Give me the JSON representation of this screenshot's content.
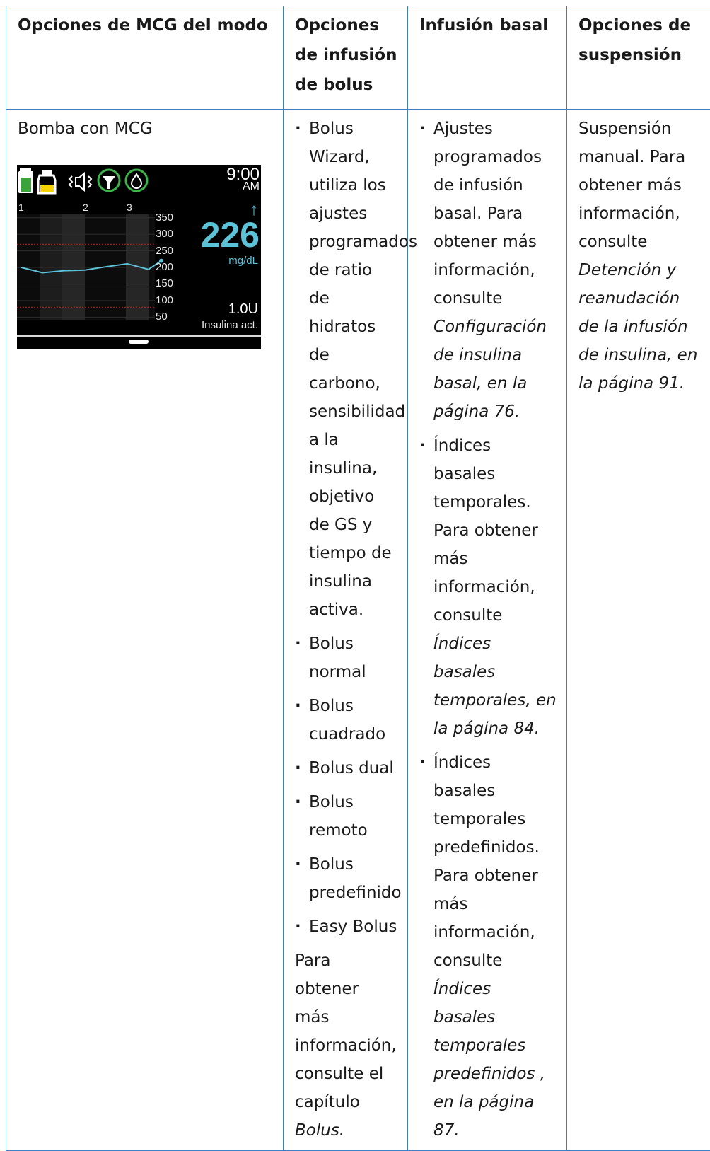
{
  "headers": {
    "col1": "Opciones de MCG del modo",
    "col2": "Opciones de infusión de bolus",
    "col3": "Infusión basal",
    "col4": "Opciones de suspensión"
  },
  "row": {
    "mode": "Bomba con MCG",
    "bolus_items": [
      "Bolus Wizard, utiliza los ajustes programados de ratio de hidratos de carbono, sensibilidad a la insulina, objetivo de GS y tiempo de insulina activa.",
      "Bolus normal",
      "Bolus cuadrado",
      "Bolus dual",
      "Bolus remoto",
      "Bolus predefinido",
      "Easy Bolus"
    ],
    "bolus_note": "Para obtener más información, consulte el capítulo",
    "bolus_note_ref": "Bolus.",
    "basal_items": [
      {
        "text": "Ajustes programados de infusión basal. Para obtener más información, consulte",
        "ref": "Configuración de insulina basal, en la página 76."
      },
      {
        "text": "Índices basales temporales. Para obtener más información, consulte",
        "ref": "Índices basales temporales, en la página 84."
      },
      {
        "text": "Índices basales temporales predefinidos. Para obtener más información, consulte",
        "ref": "Índices basales temporales predefinidos , en la página 87."
      }
    ],
    "suspend_text": "Suspensión manual. Para obtener más información, consulte",
    "suspend_ref": "Detención y reanudación de la infusión de insulina, en la página 91."
  },
  "pump_screen": {
    "time": "9:00",
    "ampm": "AM",
    "glucose": "226",
    "unit": "mg/dL",
    "trend": "↑",
    "active_insulin_value": "1.0U",
    "active_insulin_label": "Insulina act.",
    "hour_labels": [
      "1",
      "2",
      "3"
    ],
    "y_ticks": [
      "350",
      "300",
      "250",
      "200",
      "150",
      "100",
      "50"
    ],
    "status_icons": [
      "battery-icon",
      "reservoir-icon",
      "audio-vibrate-icon",
      "sensor-connection-icon",
      "calibration-drop-icon"
    ],
    "colors": {
      "accent": "#5bc2d8",
      "battery": "#3aa33c",
      "reservoir": "#f5d200",
      "ring": "#3bb54a",
      "limit_line": "#b22222"
    },
    "chart_data": {
      "type": "line",
      "x": [
        0,
        0.5,
        1,
        1.5,
        2,
        2.5,
        3,
        3.3
      ],
      "y": [
        200,
        184,
        190,
        192,
        202,
        211,
        194,
        220
      ],
      "ylim": [
        40,
        360
      ],
      "high_limit": 270,
      "low_limit": 80
    }
  }
}
